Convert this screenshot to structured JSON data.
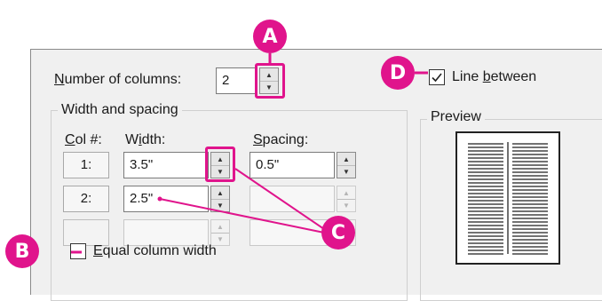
{
  "dialog": {
    "number_of_columns_label": "Number of columns:",
    "number_of_columns_value": "2",
    "line_between_label": "Line between",
    "line_between_checked": true,
    "width_spacing_group": "Width and spacing",
    "preview_group": "Preview",
    "headers": {
      "col": "Col #:",
      "width": "Width:",
      "spacing": "Spacing:"
    },
    "rows": [
      {
        "col": "1:",
        "width": "3.5\"",
        "spacing": "0.5\"",
        "spacing_enabled": true
      },
      {
        "col": "2:",
        "width": "2.5\"",
        "spacing": "",
        "spacing_enabled": false
      },
      {
        "col": "",
        "width": "",
        "spacing": "",
        "spacing_enabled": false
      }
    ],
    "equal_column_width_label": "Equal column width",
    "equal_column_width_checked": false
  },
  "callouts": {
    "a": "A",
    "b": "B",
    "c": "C",
    "d": "D"
  },
  "colors": {
    "accent": "#e0148c",
    "dialog_bg": "#f0f0f0"
  },
  "icons": {
    "spin_up": "▲",
    "spin_down": "▼",
    "check": "check-icon"
  }
}
